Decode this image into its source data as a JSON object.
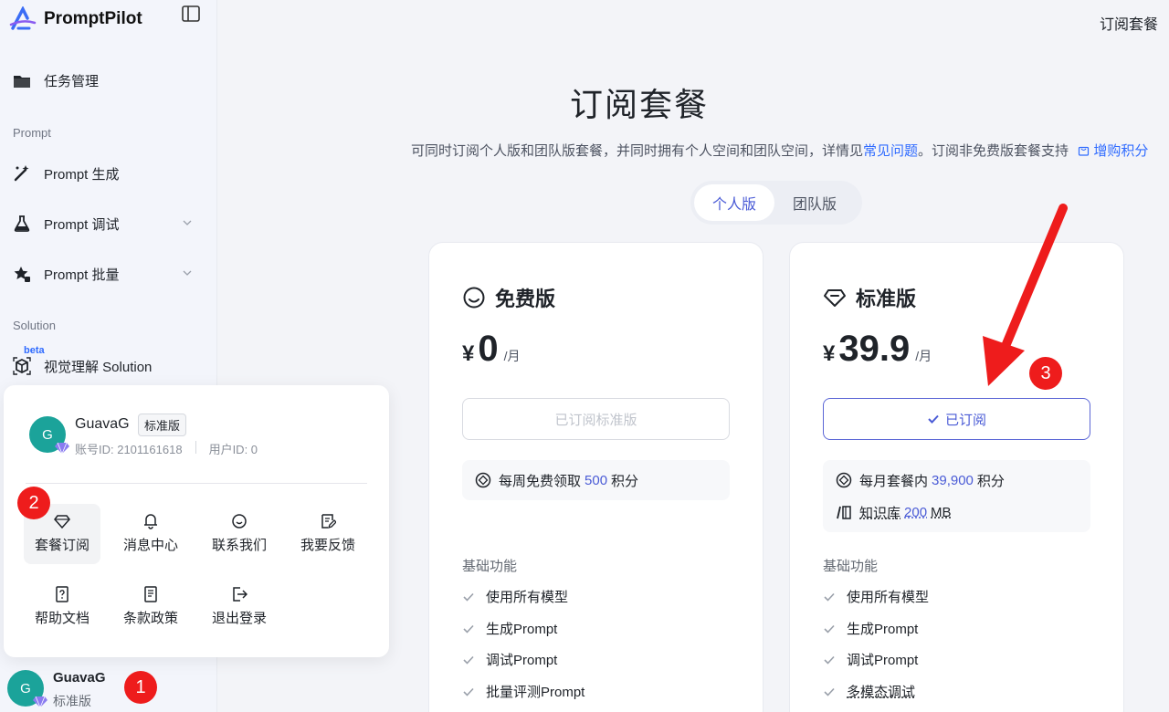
{
  "app": {
    "name": "PromptPilot"
  },
  "sidebar": {
    "task_mgmt": "任务管理",
    "section_prompt": "Prompt",
    "prompt_gen": "Prompt 生成",
    "prompt_debug": "Prompt 调试",
    "prompt_batch": "Prompt 批量",
    "section_solution": "Solution",
    "beta": "beta",
    "visual": "视觉理解 Solution"
  },
  "user": {
    "avatar_letter": "G",
    "name": "GuavaG",
    "plan": "标准版",
    "account_id": "账号ID: 2101161618",
    "user_id": "用户ID: 0"
  },
  "popup_menu": {
    "subscription": "套餐订阅",
    "messages": "消息中心",
    "contact": "联系我们",
    "feedback": "我要反馈",
    "help": "帮助文档",
    "terms": "条款政策",
    "logout": "退出登录"
  },
  "header": {
    "page_title": "订阅套餐"
  },
  "main": {
    "title": "订阅套餐",
    "subtitle_pre": "可同时订阅个人版和团队版套餐，并同时拥有个人空间和团队空间，详情见",
    "faq_link": "常见问题",
    "subtitle_mid": "。订阅非免费版套餐支持",
    "buy_points_link": "增购积分",
    "tabs": [
      "个人版",
      "团队版"
    ]
  },
  "plans": {
    "free": {
      "name": "免费版",
      "currency": "¥",
      "price": "0",
      "unit": "/月",
      "button": "已订阅标准版",
      "benefit_pre": "每周免费领取",
      "benefit_num": "500",
      "benefit_suf": "积分",
      "features_head": "基础功能",
      "features": [
        "使用所有模型",
        "生成Prompt",
        "调试Prompt",
        "批量评测Prompt"
      ]
    },
    "standard": {
      "name": "标准版",
      "currency": "¥",
      "price": "39.9",
      "unit": "/月",
      "button": "已订阅",
      "benefit_pre": "每月套餐内",
      "benefit_num": "39,900",
      "benefit_suf": "积分",
      "kb_pre": "知识库",
      "kb_num": "200",
      "kb_unit": "MB",
      "features_head": "基础功能",
      "features": [
        "使用所有模型",
        "生成Prompt",
        "调试Prompt",
        "多模态调试"
      ]
    }
  },
  "annotations": [
    "1",
    "2",
    "3"
  ],
  "colors": {
    "accent": "#4a5bd6",
    "annotation_red": "#ee1c1c",
    "avatar": "#1ba39a"
  }
}
